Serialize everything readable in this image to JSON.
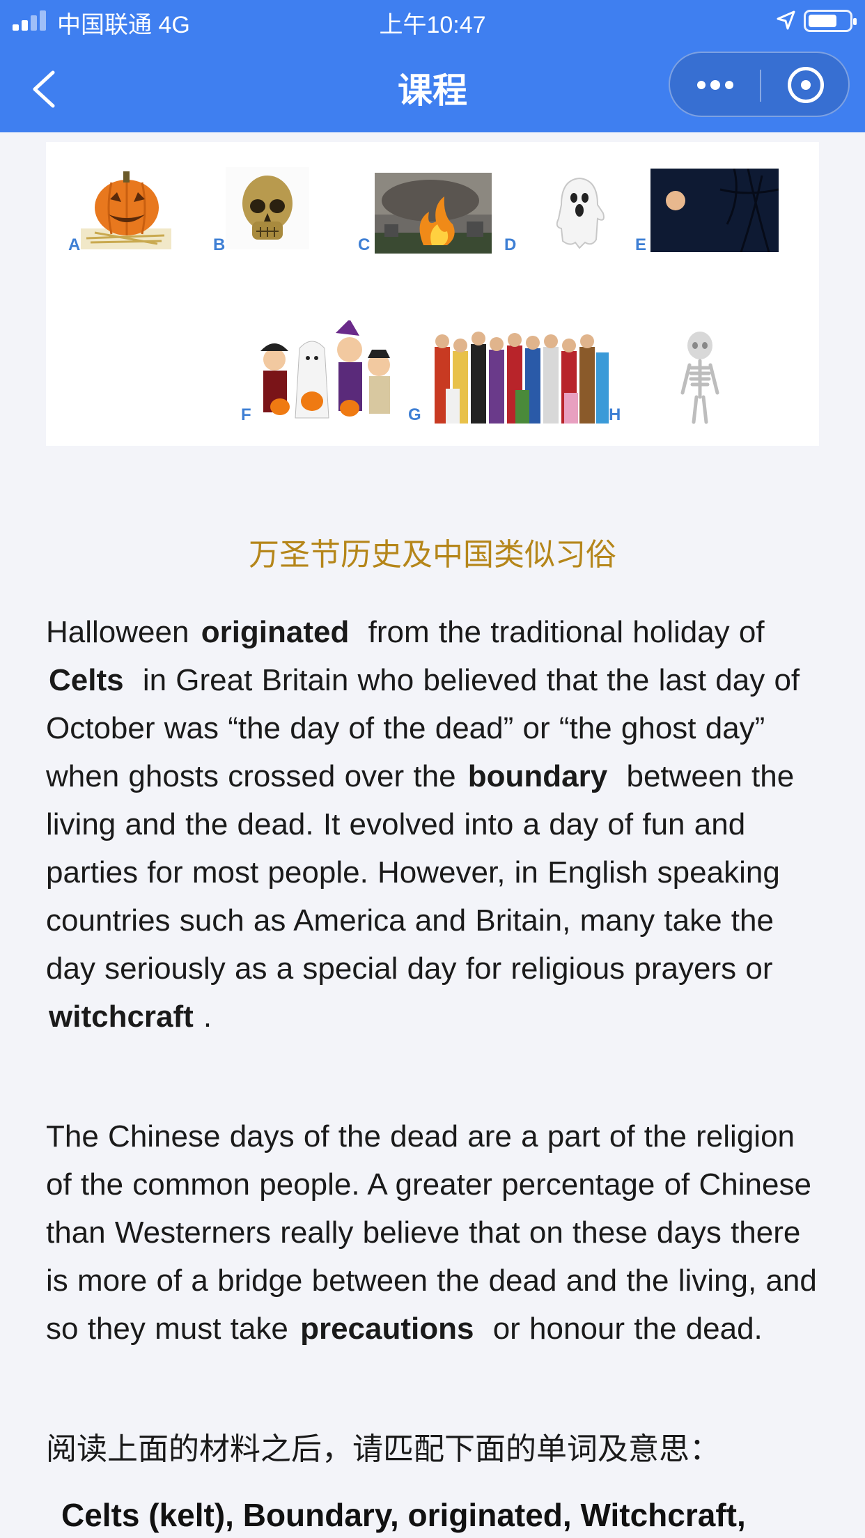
{
  "status_bar": {
    "carrier": "中国联通 4G",
    "time": "上午10:47"
  },
  "nav": {
    "title": "课程",
    "back_icon": "chevron-left-icon",
    "more_icon": "more-dots-icon",
    "close_icon": "target-circle-icon"
  },
  "image_card": {
    "labels": [
      "A",
      "B",
      "C",
      "D",
      "E",
      "F",
      "G",
      "H"
    ],
    "pictures": [
      "jack-o-lantern",
      "skull",
      "bonfire",
      "ghost",
      "full-moon",
      "trick-or-treat kids",
      "costume crowd",
      "skeleton"
    ]
  },
  "article": {
    "section_title": "万圣节历史及中国类似习俗",
    "p1": {
      "t1": "Halloween",
      "w1": "originated",
      "t2": "from the traditional holiday of",
      "w2": "Celts",
      "t3": "in Great Britain who believed that the last day of October was “the day of the dead” or “the ghost day” when ghosts crossed over the",
      "w3": "boundary",
      "t4": "between the living and the dead. It evolved into a day of fun and parties for most people. However, in English speaking countries such as America and Britain, many take the day seriously as a special day for religious prayers or",
      "w4": "witchcraft",
      "t5": "."
    },
    "p2": {
      "t1": "The Chinese days of the dead are a part of the religion of the common people. A greater percentage of Chinese than Westerners really believe that on these days there is more of a bridge between the dead and the living, and so they must take",
      "w1": "precautions",
      "t2": "or honour the dead."
    },
    "instruction": "阅读上面的材料之后，请匹配下面的单词及意思：",
    "word_list": "Celts (kelt), Boundary, originated, Witchcraft,"
  },
  "colors": {
    "nav_bg": "#3f7ff0",
    "title_gold": "#b5861a",
    "label_blue": "#3e7fd4",
    "page_bg": "#f3f4f9"
  }
}
